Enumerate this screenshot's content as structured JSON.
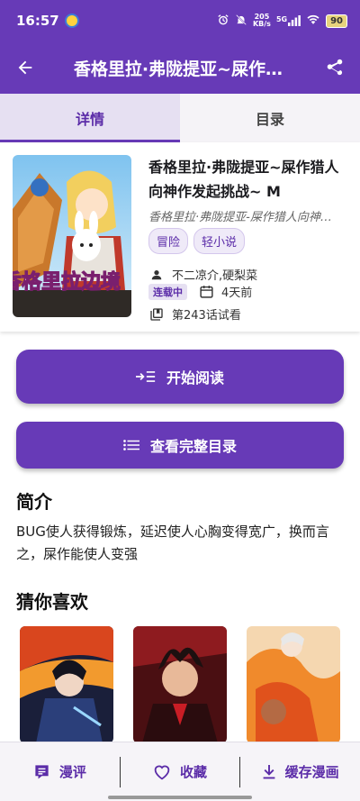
{
  "status": {
    "time": "16:57",
    "net_speed_value": "205",
    "net_speed_unit": "KB/s",
    "network": "5G",
    "battery": "90"
  },
  "app_bar": {
    "title": "香格里拉·弗陇提亚~屎作…"
  },
  "tabs": [
    {
      "label": "详情",
      "active": true
    },
    {
      "label": "目录",
      "active": false
    }
  ],
  "book": {
    "title": "香格里拉·弗陇提亚~屎作猎人向神作发起挑战~ M",
    "alt_title": "香格里拉·弗陇提亚-屎作猎人向神…",
    "tags": [
      "冒险",
      "轻小说"
    ],
    "authors": "不二凉介,硬梨菜",
    "status_badge": "连载中",
    "updated": "4天前",
    "read_progress": "第243话试看",
    "cover_text": "香格里拉边境"
  },
  "actions": {
    "start_reading": "开始阅读",
    "full_catalog": "查看完整目录"
  },
  "intro": {
    "heading": "简介",
    "text": "BUG使人获得锻炼，延迟使人心胸变得宽广，换而言之，屎作能使人变强"
  },
  "recommend": {
    "heading": "猜你喜欢"
  },
  "bottom_nav": {
    "comments": "漫评",
    "favorite": "收藏",
    "download": "缓存漫画"
  },
  "colors": {
    "primary": "#673ab7",
    "tab_active_bg": "#e6e0f2",
    "accent_text": "#5b2ca8"
  }
}
